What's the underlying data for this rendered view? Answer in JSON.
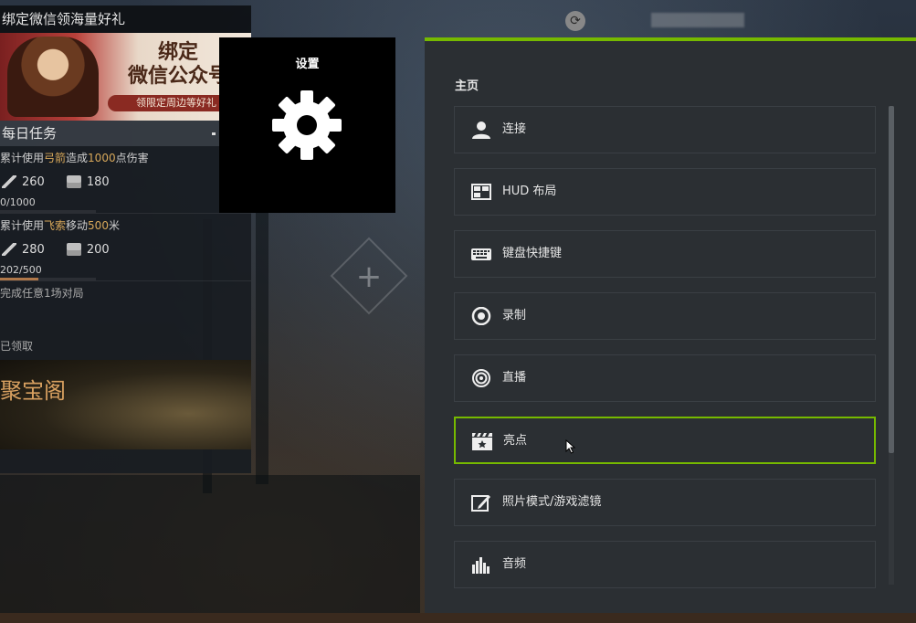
{
  "game_panel": {
    "bind_header": "绑定微信领海量好礼",
    "banner": {
      "title_line1": "绑定",
      "title_line2": "微信公众号",
      "subtitle": "领限定周边等好礼"
    },
    "daily_title": "每日任务",
    "tasks": [
      {
        "desc_prefix": "累计使用",
        "desc_highlight": "弓箭",
        "desc_mid": "造成",
        "desc_highlight2": "1000",
        "desc_suffix": "点伤害",
        "reward1": "260",
        "reward2": "180",
        "progress": "0/1000",
        "progress_fraction": 0.0
      },
      {
        "desc_prefix": "累计使用",
        "desc_highlight": "飞索",
        "desc_mid": "移动",
        "desc_highlight2": "500",
        "desc_suffix": "米",
        "reward1": "280",
        "reward2": "200",
        "progress": "202/500",
        "progress_fraction": 0.404
      },
      {
        "desc_prefix": "完成任意",
        "desc_highlight": "1",
        "desc_suffix": "场对局"
      }
    ],
    "claimed": "已领取",
    "treasure_title": "聚宝阁"
  },
  "settings_tile": {
    "label": "设置",
    "icon": "gear-icon"
  },
  "settings_panel": {
    "accent_color": "#76b900",
    "section_title": "主页",
    "items": [
      {
        "label": "连接",
        "icon": "user-icon",
        "selected": false
      },
      {
        "label": "HUD 布局",
        "icon": "layout-icon",
        "selected": false
      },
      {
        "label": "键盘快捷键",
        "icon": "keyboard-icon",
        "selected": false
      },
      {
        "label": "录制",
        "icon": "record-icon",
        "selected": false
      },
      {
        "label": "直播",
        "icon": "broadcast-icon",
        "selected": false
      },
      {
        "label": "亮点",
        "icon": "clapper-icon",
        "selected": true
      },
      {
        "label": "照片模式/游戏滤镜",
        "icon": "photo-edit-icon",
        "selected": false
      },
      {
        "label": "音频",
        "icon": "audio-icon",
        "selected": false
      }
    ]
  }
}
